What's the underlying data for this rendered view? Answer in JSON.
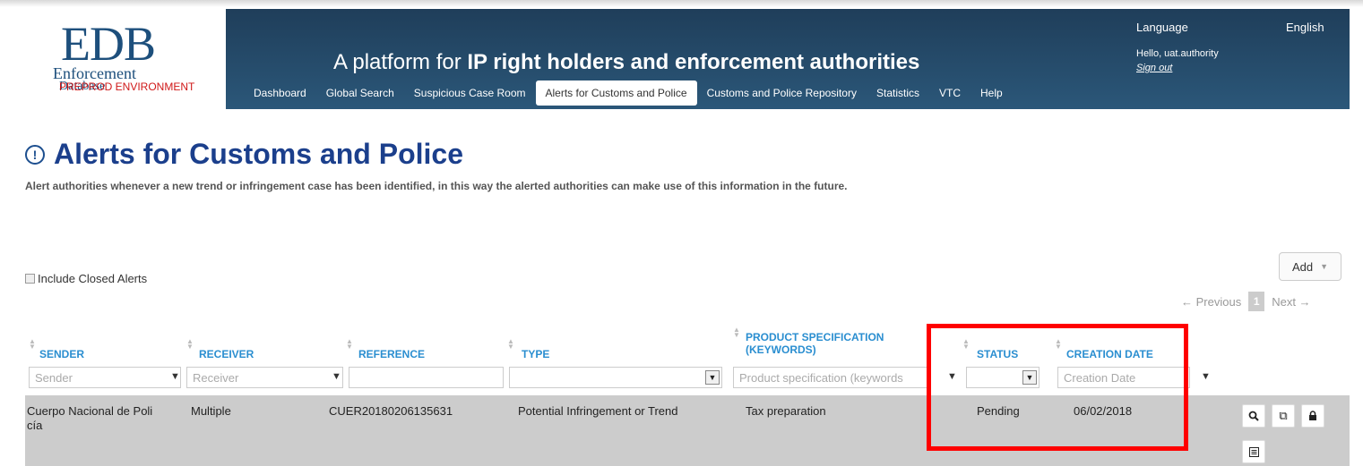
{
  "logo": {
    "big": "EDB",
    "line1": "Enforcement",
    "line2": "Database",
    "env": "PREPROD ENVIRONMENT"
  },
  "header": {
    "tagline_prefix": "A platform for ",
    "tagline_bold": "IP right holders and enforcement authorities",
    "language_label": "Language",
    "language_value": "English",
    "hello": "Hello, uat.authority",
    "signout": "Sign out"
  },
  "nav": {
    "items": [
      "Dashboard",
      "Global Search",
      "Suspicious Case Room",
      "Alerts for Customs and Police",
      "Customs and Police Repository",
      "Statistics",
      "VTC",
      "Help"
    ],
    "active_index": 3
  },
  "page": {
    "title": "Alerts for Customs and Police",
    "subtitle": "Alert authorities whenever a new trend or infringement case has been identified, in this way the alerted authorities can make use of this information in the future.",
    "add_label": "Add",
    "include_closed_label": "Include Closed Alerts"
  },
  "pager": {
    "previous": "← Previous",
    "current": "1",
    "next": "Next →"
  },
  "table": {
    "headers": [
      "SENDER",
      "RECEIVER",
      "REFERENCE",
      "TYPE",
      "PRODUCT SPECIFICATION",
      "(KEYWORDS)",
      "STATUS",
      "CREATION DATE"
    ],
    "filters": {
      "sender": "Sender",
      "receiver": "Receiver",
      "product": "Product specification (keywords",
      "creation_date": "Creation Date"
    },
    "row": {
      "sender_line1": "Cuerpo Nacional de Poli",
      "sender_line2": "cía",
      "receiver": "Multiple",
      "reference": "CUER20180206135631",
      "type": "Potential Infringement or Trend",
      "product": "Tax preparation",
      "status": "Pending",
      "creation_date": "06/02/2018"
    }
  },
  "colors": {
    "header_bg": "#2b5779",
    "title": "#1b3f8c",
    "column_head": "#2a8ed0",
    "highlight": "#ff0000",
    "row_bg": "#cccccc"
  }
}
